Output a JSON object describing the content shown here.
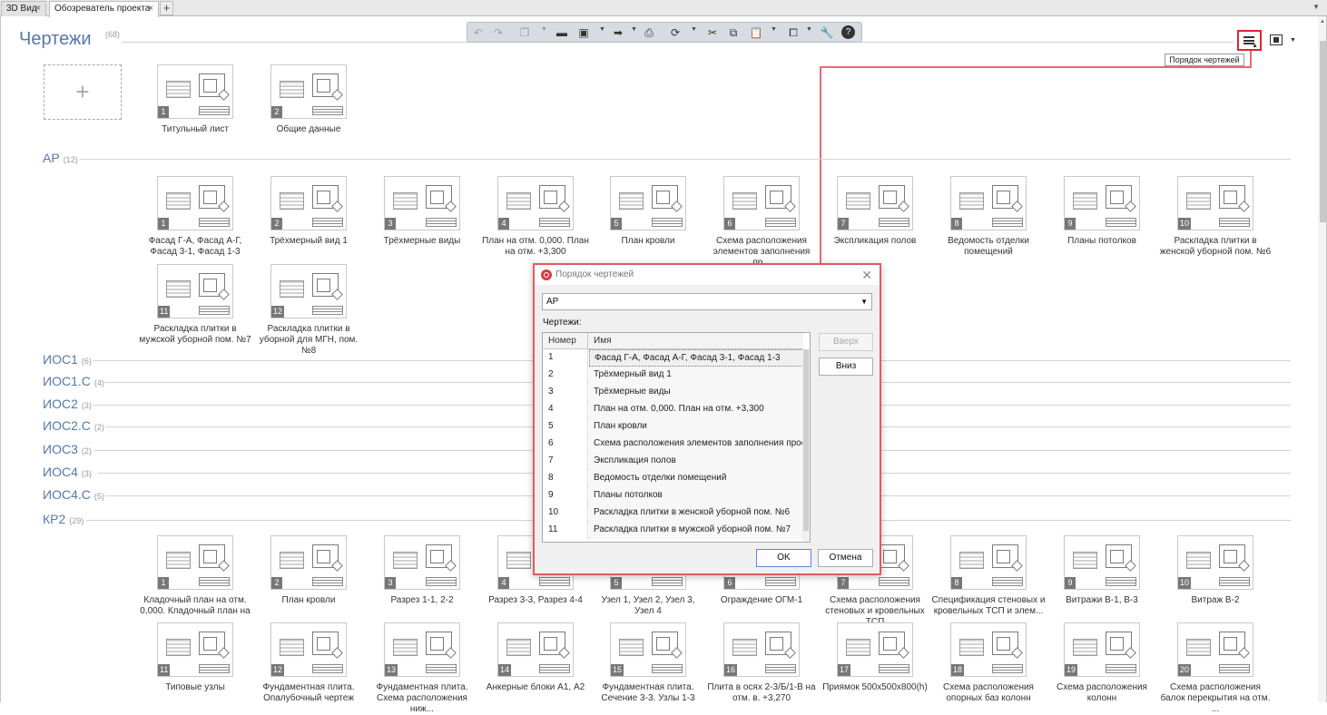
{
  "tabs": [
    {
      "label": "3D Вид"
    },
    {
      "label": "Обозреватель проекта"
    }
  ],
  "header": {
    "title": "Чертежи",
    "count": "(68)"
  },
  "tooltip": "Порядок чертежей",
  "icons": {
    "undo": "undo-icon",
    "redo": "redo-icon",
    "open": "folder-icon",
    "save": "save-icon",
    "export": "export-icon",
    "print": "printer-icon",
    "sync": "sync-icon",
    "cut": "scissors-icon",
    "copy": "copy-icon",
    "paste": "paste-icon",
    "layers": "layers-icon",
    "settings": "wrench-icon",
    "help": "help-icon",
    "order": "sort-order-icon",
    "view": "view-mode-icon"
  },
  "top_cards": [
    {
      "num": "1",
      "label": "Титульный лист"
    },
    {
      "num": "2",
      "label": "Общие данные"
    }
  ],
  "sections": [
    {
      "name": "АР",
      "count": "(12)",
      "cards": [
        {
          "num": "1",
          "label": "Фасад Г-А, Фасад А-Г, Фасад 3-1, Фасад 1-3"
        },
        {
          "num": "2",
          "label": "Трёхмерный вид 1"
        },
        {
          "num": "3",
          "label": "Трёхмерные виды"
        },
        {
          "num": "4",
          "label": "План на отм. 0,000. План на отм. +3,300"
        },
        {
          "num": "5",
          "label": "План кровли"
        },
        {
          "num": "6",
          "label": "Схема расположения элементов заполнения пр..."
        },
        {
          "num": "7",
          "label": "Экспликация полов"
        },
        {
          "num": "8",
          "label": "Ведомость отделки помещений"
        },
        {
          "num": "9",
          "label": "Планы потолков"
        },
        {
          "num": "10",
          "label": "Раскладка плитки в женской уборной пом. №6"
        },
        {
          "num": "11",
          "label": "Раскладка плитки в мужской уборной пом. №7"
        },
        {
          "num": "12",
          "label": "Раскладка плитки в уборной для МГН, пом. №8"
        }
      ]
    },
    {
      "name": "ИОС1",
      "count": "(6)"
    },
    {
      "name": "ИОС1.С",
      "count": "(4)"
    },
    {
      "name": "ИОС2",
      "count": "(3)"
    },
    {
      "name": "ИОС2.С",
      "count": "(2)"
    },
    {
      "name": "ИОС3",
      "count": "(2)"
    },
    {
      "name": "ИОС4",
      "count": "(3)"
    },
    {
      "name": "ИОС4.С",
      "count": "(5)"
    },
    {
      "name": "КР2",
      "count": "(29)",
      "cards": [
        {
          "num": "1",
          "label": "Кладочный план на отм. 0,000. Кладочный план на ..."
        },
        {
          "num": "2",
          "label": "План кровли"
        },
        {
          "num": "3",
          "label": "Разрез 1-1, 2-2"
        },
        {
          "num": "4",
          "label": "Разрез 3-3, Разрез 4-4"
        },
        {
          "num": "5",
          "label": "Узел 1, Узел 2, Узел 3, Узел 4"
        },
        {
          "num": "6",
          "label": "Ограждение ОГМ-1"
        },
        {
          "num": "7",
          "label": "Схема расположения стеновых и кровельных ТСП"
        },
        {
          "num": "8",
          "label": "Спецификация стеновых и кровельных ТСП и элем..."
        },
        {
          "num": "9",
          "label": "Витражи В-1, В-3"
        },
        {
          "num": "10",
          "label": "Витраж В-2"
        },
        {
          "num": "11",
          "label": "Типовые узлы"
        },
        {
          "num": "12",
          "label": "Фундаментная плита. Опалубочный чертеж"
        },
        {
          "num": "13",
          "label": "Фундаментная плита. Схема расположения ниж..."
        },
        {
          "num": "14",
          "label": "Анкерные блоки А1, А2"
        },
        {
          "num": "15",
          "label": "Фундаментная плита. Сечение 3-3. Узлы 1-3"
        },
        {
          "num": "16",
          "label": "Плита в осях 2-3/Б/1-В на отм. в. +3,270"
        },
        {
          "num": "17",
          "label": "Приямок 500х500х800(h)"
        },
        {
          "num": "18",
          "label": "Схема расположения опорных баз колонн"
        },
        {
          "num": "19",
          "label": "Схема расположения колонн"
        },
        {
          "num": "20",
          "label": "Схема расположения балок перекрытия на отм. ..."
        }
      ]
    }
  ],
  "dialog": {
    "title": "Порядок чертежей",
    "selected": "АР",
    "list_label": "Чертежи:",
    "col_num": "Номер",
    "col_name": "Имя",
    "rows": [
      {
        "num": "1",
        "name": "Фасад Г-А, Фасад А-Г, Фасад 3-1, Фасад 1-3"
      },
      {
        "num": "2",
        "name": "Трёхмерный вид 1"
      },
      {
        "num": "3",
        "name": "Трёхмерные виды"
      },
      {
        "num": "4",
        "name": "План на отм. 0,000. План на отм. +3,300"
      },
      {
        "num": "5",
        "name": "План кровли"
      },
      {
        "num": "6",
        "name": "Схема расположения элементов заполнения проё..."
      },
      {
        "num": "7",
        "name": "Экспликация полов"
      },
      {
        "num": "8",
        "name": "Ведомость отделки помещений"
      },
      {
        "num": "9",
        "name": "Планы потолков"
      },
      {
        "num": "10",
        "name": "Раскладка плитки в женской уборной пом. №6"
      },
      {
        "num": "11",
        "name": "Раскладка плитки в мужской уборной пом. №7"
      }
    ],
    "up": "Вверх",
    "down": "Вниз",
    "ok": "OK",
    "cancel": "Отмена"
  }
}
